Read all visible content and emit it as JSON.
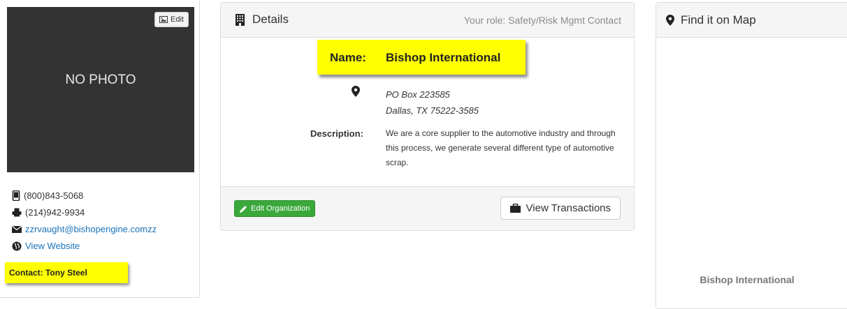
{
  "left_card": {
    "photo_edit_label": "Edit",
    "no_photo_text": "NO PHOTO",
    "phone": "(800)843-5068",
    "fax": "(214)942-9934",
    "email": "zzrvaught@bishopengine.comzz",
    "website_label": "View Website",
    "contact_label": "Contact: Tony Steel"
  },
  "details": {
    "title": "Details",
    "role_text": "Your role: Safety/Risk Mgmt Contact",
    "name_label": "Name:",
    "name_value": "Bishop International",
    "address_line1": "PO Box 223585",
    "address_line2": "Dallas, TX 75222-3585",
    "description_label": "Description:",
    "description_text": "We are a core supplier to the automotive industry and through this process, we generate several different type of automotive scrap.",
    "edit_button_label": "Edit Organization",
    "view_transactions_label": "View Transactions"
  },
  "map": {
    "title": "Find it on Map",
    "marker_label": "Bishop International"
  },
  "icons": {
    "photo": "picture-icon",
    "phone": "mobile-phone-icon",
    "fax": "fax-icon",
    "email": "envelope-icon",
    "website": "globe-icon",
    "details": "building-icon",
    "location": "map-marker-icon",
    "edit": "pencil-icon",
    "transactions": "briefcase-icon"
  },
  "colors": {
    "highlight": "#ffff00",
    "success": "#3aa83a",
    "link": "#1a73b8",
    "photo_bg": "#333333"
  }
}
